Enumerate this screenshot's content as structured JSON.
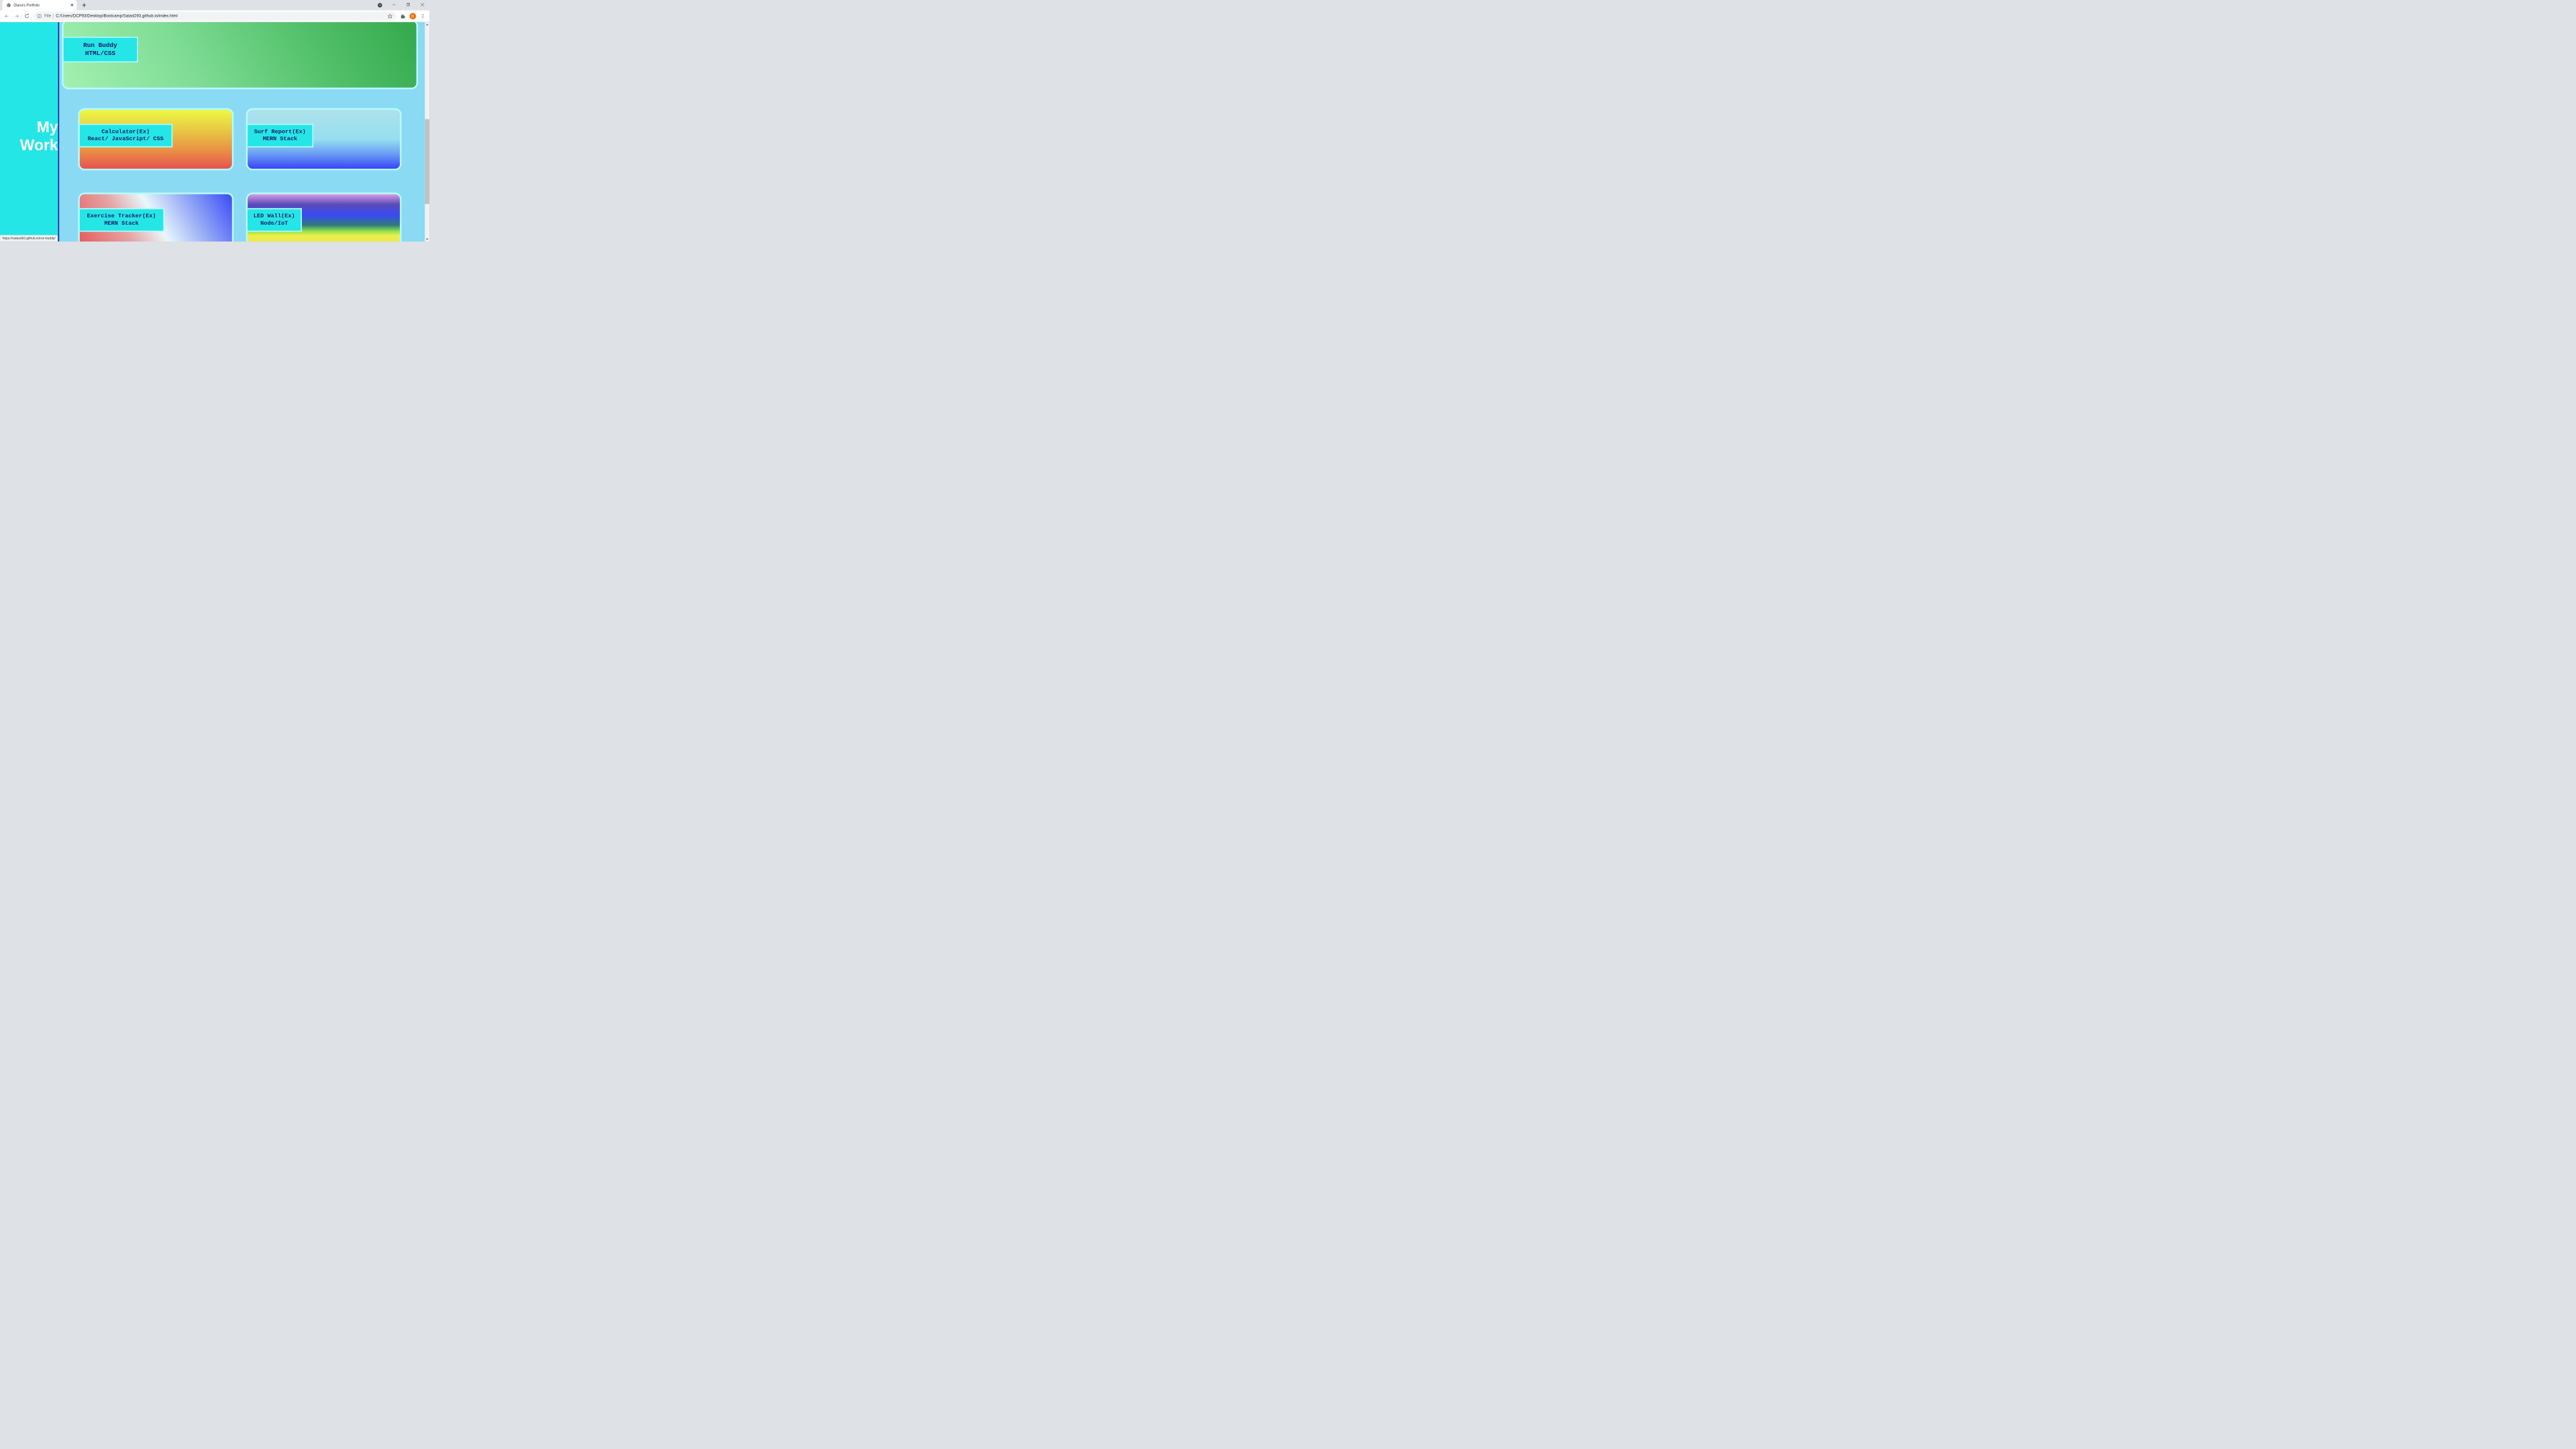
{
  "browser": {
    "tab_title": "Diana's Portfolio",
    "url_scheme": "File",
    "url": "C:/Users/DCP93/Desktop/Bootcamp/SalasD93.github.io/index.html",
    "profile_initial": "D",
    "status_url": "https://salasd93.github.io/run-buddy/"
  },
  "page": {
    "heading_line1": "My",
    "heading_line2": "Work",
    "projects": [
      {
        "name": "Run Buddy",
        "tech": "HTML/CSS"
      },
      {
        "name": "Calculator(Ex)",
        "tech": "React/ JavaScript/ CSS"
      },
      {
        "name": "Surf Report(Ex)",
        "tech": "MERN Stack"
      },
      {
        "name": "Exercise Tracker(Ex)",
        "tech": "MERN Stack"
      },
      {
        "name": "LED Wall(Ex)",
        "tech": "Node/IoT"
      }
    ]
  },
  "colors": {
    "sidebar": "#25e6e6",
    "page_bg": "#8adaf3",
    "card_border": "#b7fbfb",
    "label_text": "#1a1a6b",
    "divider": "#1a1b9e"
  },
  "icons": [
    "globe-icon",
    "close-icon",
    "plus-icon",
    "profile-menu-icon",
    "minimize-icon",
    "restore-icon",
    "window-close-icon",
    "back-icon",
    "forward-icon",
    "reload-icon",
    "info-icon",
    "star-icon",
    "extensions-icon",
    "kebab-icon"
  ]
}
